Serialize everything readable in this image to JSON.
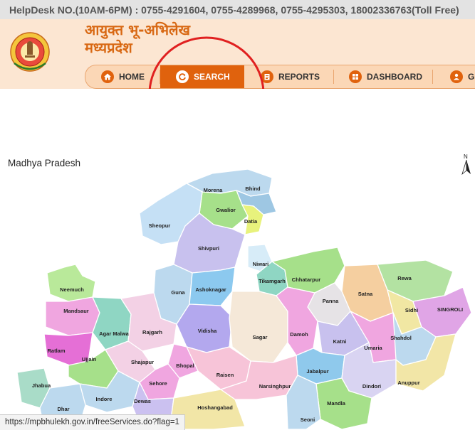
{
  "helpdesk": "HelpDesk NO.(10AM-6PM) : 0755-4291604, 0755-4289968, 0755-4295303, 18002336763(Toll Free)",
  "site_title": {
    "line1": "आयुक्त भू-अभिलेख",
    "line2": "मध्यप्रदेश"
  },
  "nav": [
    {
      "label": "HOME",
      "icon": "home-icon"
    },
    {
      "label": "SEARCH",
      "icon": "refresh-icon",
      "active": true
    },
    {
      "label": "REPORTS",
      "icon": "report-icon"
    },
    {
      "label": "DASHBOARD",
      "icon": "dashboard-icon"
    },
    {
      "label": "G",
      "icon": "person-icon"
    }
  ],
  "map": {
    "title": "Madhya Pradesh",
    "north_label": "N",
    "districts": [
      "Morena",
      "Bhind",
      "Gwalior",
      "Datia",
      "Sheopur",
      "Shivpuri",
      "Niwari",
      "Tikamgarh",
      "Chhatarpur",
      "Rewa",
      "Neemuch",
      "Guna",
      "Ashoknagar",
      "Satna",
      "Panna",
      "Sidhi",
      "SINGROLI",
      "Mandsaur",
      "Agar Malwa",
      "Rajgarh",
      "Vidisha",
      "Sagar",
      "Damoh",
      "Katni",
      "Umaria",
      "Shahdol",
      "Ratlam",
      "Ujjain",
      "Shajapur",
      "Bhopal",
      "Raisen",
      "Jabalpur",
      "Dindori",
      "Anuppur",
      "Jhabua",
      "Sehore",
      "Narsinghpur",
      "Indore",
      "Dewas",
      "Mandla",
      "Dhar",
      "Hoshangabad",
      "Seoni"
    ]
  },
  "status_url": "https://mpbhulekh.gov.in/freeServices.do?flag=1",
  "colors": {
    "accent": "#e0620d",
    "header_bg": "#fce6d2",
    "annotation_circle": "#e02020"
  }
}
